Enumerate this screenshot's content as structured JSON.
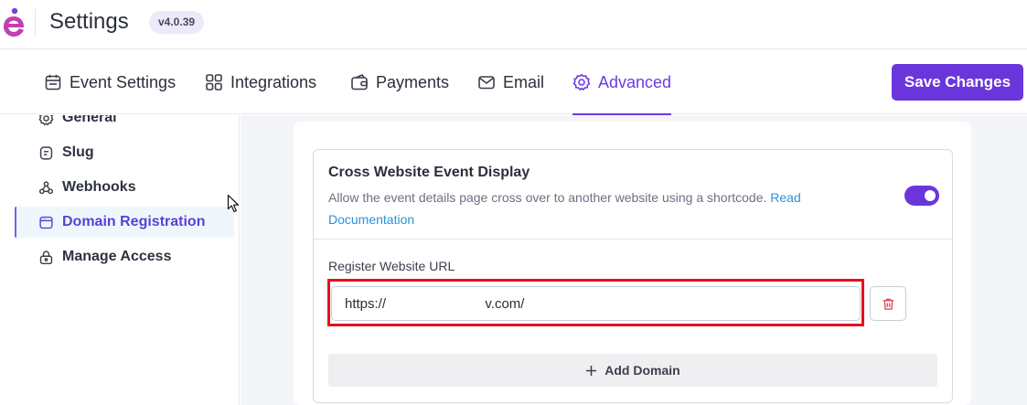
{
  "header": {
    "title": "Settings",
    "version": "v4.0.39"
  },
  "tabs": [
    {
      "label": "Event Settings",
      "icon": "calendar-icon"
    },
    {
      "label": "Integrations",
      "icon": "grid-icon"
    },
    {
      "label": "Payments",
      "icon": "wallet-icon"
    },
    {
      "label": "Email",
      "icon": "mail-icon"
    },
    {
      "label": "Advanced",
      "icon": "gear-icon",
      "active": true
    }
  ],
  "save_label": "Save Changes",
  "sidebar": {
    "items": [
      {
        "label": "General",
        "icon": "gear-icon"
      },
      {
        "label": "Slug",
        "icon": "slug-icon"
      },
      {
        "label": "Webhooks",
        "icon": "webhook-icon"
      },
      {
        "label": "Domain Registration",
        "icon": "browser-icon",
        "active": true
      },
      {
        "label": "Manage Access",
        "icon": "lock-icon"
      }
    ]
  },
  "feature": {
    "title": "Cross Website Event Display",
    "description": "Allow the event details page cross over to another website using a shortcode.",
    "link_text": "Read Documentation",
    "enabled": true,
    "url_label": "Register Website URL",
    "url_value": "https://                        ev.com/",
    "add_domain_label": "Add Domain"
  },
  "colors": {
    "accent": "#6a36dc",
    "link": "#2b93d8",
    "highlight": "#e8101a"
  }
}
